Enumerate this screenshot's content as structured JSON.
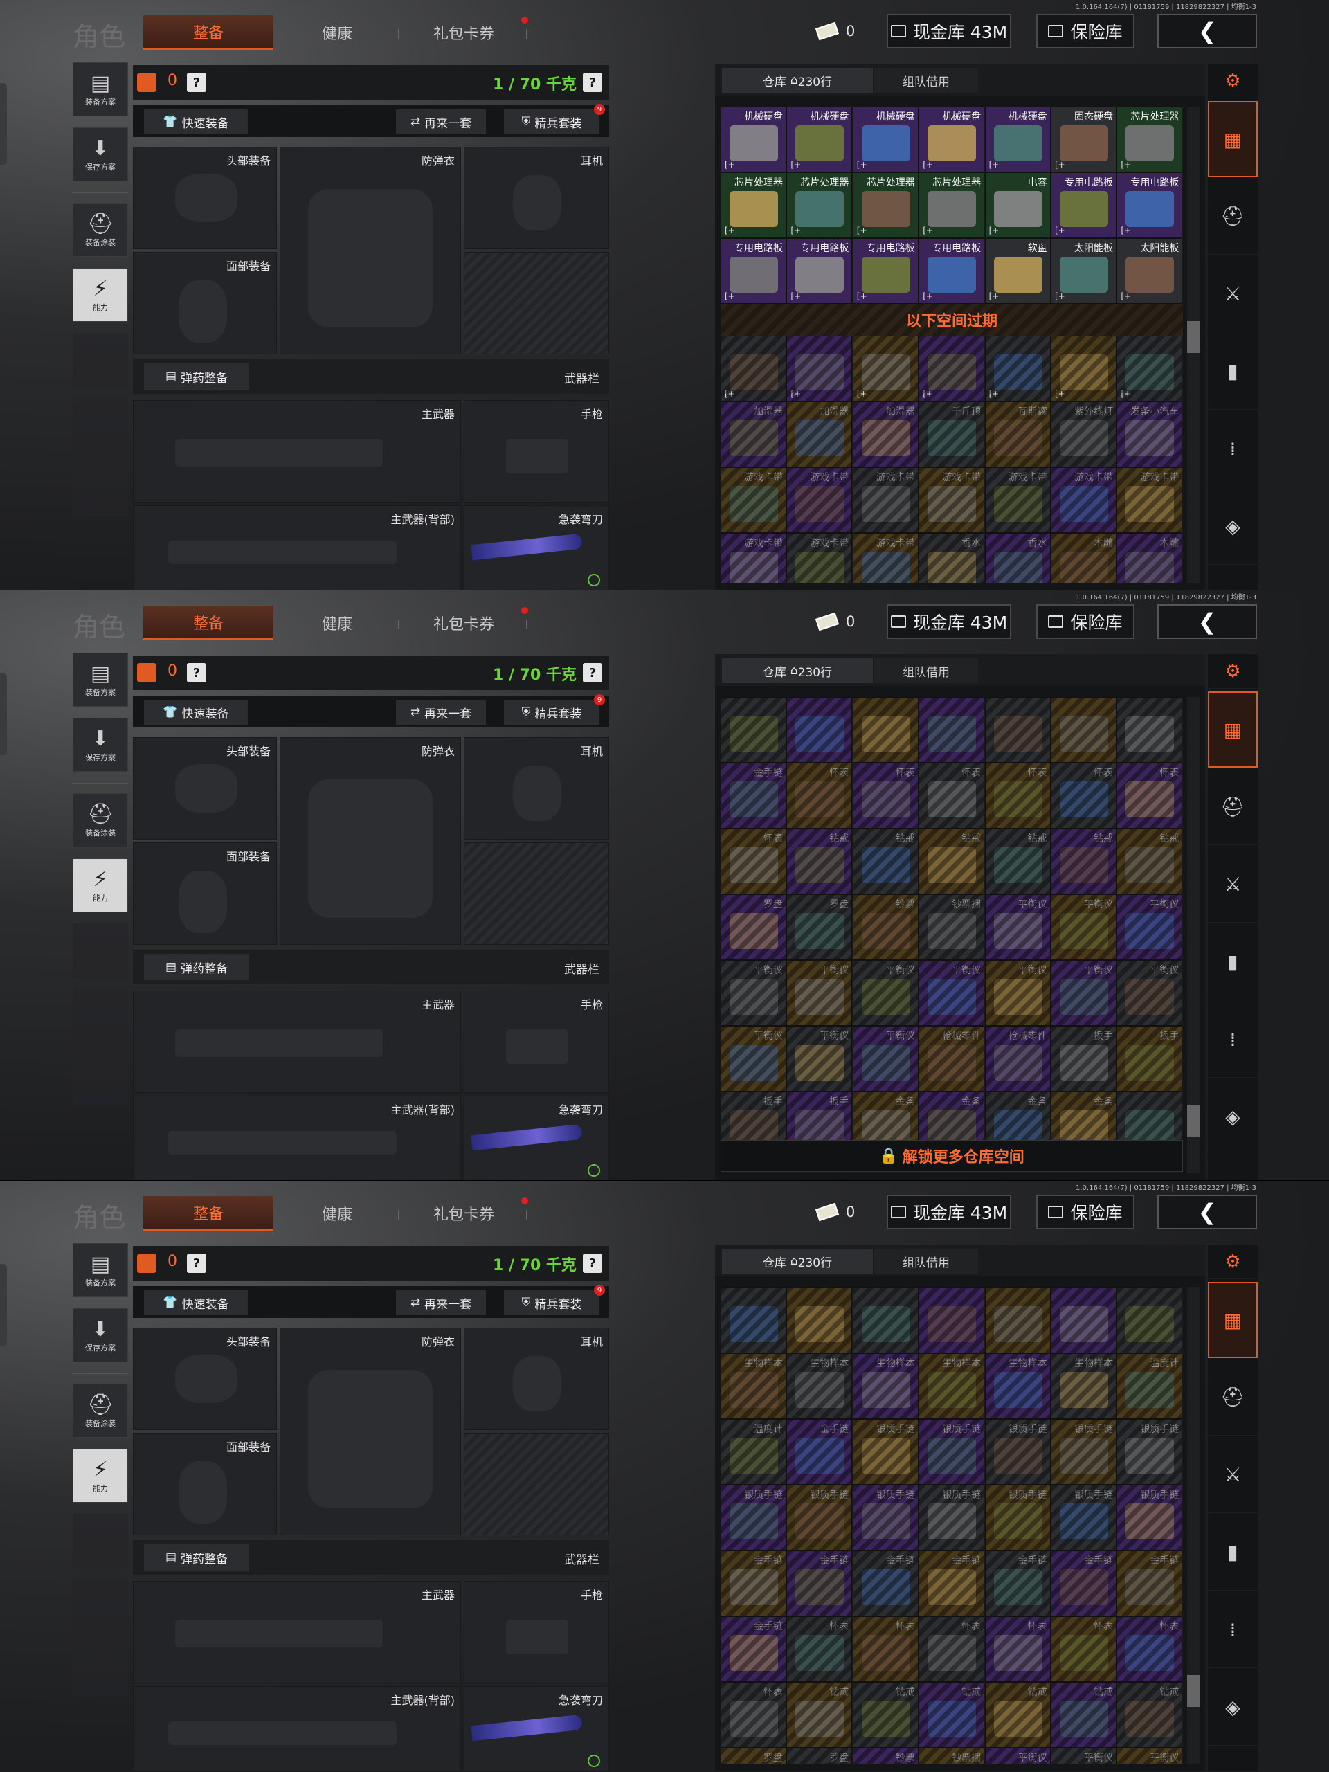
{
  "build": "1.0.164.164(7) | 01181759 | 11829822327 | 均衡1-3",
  "header": {
    "title": "角色",
    "tabs": [
      "整备",
      "健康",
      "礼包卡券"
    ],
    "cash_value": "0",
    "btn_cash": "现金库 43M",
    "btn_safe": "保险库"
  },
  "left_nav": [
    "装备方案",
    "保存方案",
    "装备涂装",
    "能力"
  ],
  "equipment": {
    "count": "0",
    "help": "?",
    "weight": "1 / 70 千克",
    "quick": "快速装备",
    "again": "再来一套",
    "elite": "精兵套装",
    "elite_badge": "9",
    "slots": {
      "head": "头部装备",
      "armor": "防弹衣",
      "ear": "耳机",
      "face": "面部装备",
      "ammo": "弹药整备",
      "weapons": "武器栏",
      "primary": "主武器",
      "pistol": "手枪",
      "back": "主武器(背部)",
      "knife": "急袭弯刀"
    }
  },
  "stash": {
    "tab_main": "仓库",
    "rows": "230行",
    "tab_team": "组队借用",
    "banner_expired": "以下空间过期",
    "banner_unlock": "解锁更多仓库空间",
    "plus": "[+",
    "views": [
      {
        "rows": [
          [
            [
              "机械硬盘",
              "#ffffff"
            ],
            [
              "机械硬盘",
              "#ffffff"
            ],
            [
              "机械硬盘",
              "#ffffff"
            ],
            [
              "机械硬盘",
              "#ffffff"
            ],
            [
              "机械硬盘",
              "#ffffff"
            ],
            [
              "固态硬盘",
              "#ffffff"
            ],
            [
              "芯片处理器",
              "#ffffff"
            ]
          ],
          [
            [
              "芯片处理器",
              "#ffffff"
            ],
            [
              "芯片处理器",
              "#ffffff"
            ],
            [
              "芯片处理器",
              "#ffffff"
            ],
            [
              "芯片处理器",
              "#ffffff"
            ],
            [
              "电容",
              "#ffffff"
            ],
            [
              "专用电路板",
              "#ffffff"
            ],
            [
              "专用电路板",
              "#ffffff"
            ]
          ],
          [
            [
              "专用电路板",
              "#ffffff"
            ],
            [
              "专用电路板",
              "#ffffff"
            ],
            [
              "专用电路板",
              "#ffffff"
            ],
            [
              "专用电路板",
              "#ffffff"
            ],
            [
              "软盘",
              "#ffffff"
            ],
            [
              "太阳能板",
              "#ffffff"
            ],
            [
              "太阳能板",
              "#ffffff"
            ]
          ],
          "expired",
          [
            [
              "",
              "#a0a0a0"
            ],
            [
              "",
              "#a0a0a0"
            ],
            [
              "",
              "#a0a0a0"
            ],
            [
              "",
              "#a0a0a0"
            ],
            [
              "",
              "#a0a0a0"
            ],
            [
              "",
              "#a0a0a0"
            ],
            [
              "",
              "#a0a0a0"
            ]
          ],
          [
            [
              "加湿器",
              "#a0a0a0"
            ],
            [
              "加湿器",
              "#a0a0a0"
            ],
            [
              "加湿器",
              "#a0a0a0"
            ],
            [
              "千斤顶",
              "#a0a0a0"
            ],
            [
              "瓦斯罐",
              "#a0a0a0"
            ],
            [
              "紫外线灯",
              "#a0a0a0"
            ],
            [
              "发条小汽车",
              "#a0a0a0"
            ]
          ],
          [
            [
              "游戏卡带",
              "#a0a0a0"
            ],
            [
              "游戏卡带",
              "#a0a0a0"
            ],
            [
              "游戏卡带",
              "#a0a0a0"
            ],
            [
              "游戏卡带",
              "#a0a0a0"
            ],
            [
              "游戏卡带",
              "#a0a0a0"
            ],
            [
              "游戏卡带",
              "#a0a0a0"
            ],
            [
              "游戏卡带",
              "#a0a0a0"
            ]
          ],
          [
            [
              "游戏卡带",
              "#a0a0a0"
            ],
            [
              "游戏卡带",
              "#a0a0a0"
            ],
            [
              "游戏卡带",
              "#a0a0a0"
            ],
            [
              "香水",
              "#a0a0a0"
            ],
            [
              "香水",
              "#a0a0a0"
            ],
            [
              "木雕",
              "#a0a0a0"
            ],
            [
              "木雕",
              "#a0a0a0"
            ]
          ]
        ]
      },
      {
        "rows": [
          [
            [
              "",
              "#a0a0a0"
            ],
            [
              "",
              "#a0a0a0"
            ],
            [
              "",
              "#a0a0a0"
            ],
            [
              "",
              "#a0a0a0"
            ],
            [
              "",
              "#a0a0a0"
            ],
            [
              "",
              "#a0a0a0"
            ],
            [
              "",
              "#a0a0a0"
            ]
          ],
          [
            [
              "金手链",
              "#a0a0a0"
            ],
            [
              "怀表",
              "#a0a0a0"
            ],
            [
              "怀表",
              "#a0a0a0"
            ],
            [
              "怀表",
              "#a0a0a0"
            ],
            [
              "怀表",
              "#a0a0a0"
            ],
            [
              "怀表",
              "#a0a0a0"
            ],
            [
              "怀表",
              "#a0a0a0"
            ]
          ],
          [
            [
              "怀表",
              "#a0a0a0"
            ],
            [
              "钻戒",
              "#a0a0a0"
            ],
            [
              "钻戒",
              "#a0a0a0"
            ],
            [
              "钻戒",
              "#a0a0a0"
            ],
            [
              "钻戒",
              "#a0a0a0"
            ],
            [
              "钻戒",
              "#a0a0a0"
            ],
            [
              "钻戒",
              "#a0a0a0"
            ]
          ],
          [
            [
              "罗盘",
              "#a0a0a0"
            ],
            [
              "罗盘",
              "#a0a0a0"
            ],
            [
              "钞票",
              "#a0a0a0"
            ],
            [
              "钞票捆",
              "#a0a0a0"
            ],
            [
              "平衡仪",
              "#a0a0a0"
            ],
            [
              "平衡仪",
              "#a0a0a0"
            ],
            [
              "平衡仪",
              "#a0a0a0"
            ]
          ],
          [
            [
              "平衡仪",
              "#a0a0a0"
            ],
            [
              "平衡仪",
              "#a0a0a0"
            ],
            [
              "平衡仪",
              "#a0a0a0"
            ],
            [
              "平衡仪",
              "#a0a0a0"
            ],
            [
              "平衡仪",
              "#a0a0a0"
            ],
            [
              "平衡仪",
              "#a0a0a0"
            ],
            [
              "平衡仪",
              "#a0a0a0"
            ]
          ],
          [
            [
              "平衡仪",
              "#a0a0a0"
            ],
            [
              "平衡仪",
              "#a0a0a0"
            ],
            [
              "平衡仪",
              "#a0a0a0"
            ],
            [
              "枪械零件",
              "#a0a0a0"
            ],
            [
              "枪械零件",
              "#a0a0a0"
            ],
            [
              "扳手",
              "#a0a0a0"
            ],
            [
              "扳手",
              "#a0a0a0"
            ]
          ],
          [
            [
              "扳手",
              "#a0a0a0"
            ],
            [
              "扳手",
              "#a0a0a0"
            ],
            [
              "金条",
              "#a0a0a0"
            ],
            [
              "金条",
              "#a0a0a0"
            ],
            [
              "金条",
              "#a0a0a0"
            ],
            [
              "金条",
              "#a0a0a0"
            ],
            [
              "",
              "#a0a0a0"
            ]
          ],
          "unlock"
        ]
      },
      {
        "rows": [
          [
            [
              "",
              "#a0a0a0"
            ],
            [
              "",
              "#a0a0a0"
            ],
            [
              "",
              "#a0a0a0"
            ],
            [
              "",
              "#a0a0a0"
            ],
            [
              "",
              "#a0a0a0"
            ],
            [
              "",
              "#a0a0a0"
            ],
            [
              "",
              "#a0a0a0"
            ]
          ],
          [
            [
              "生物样本",
              "#a0a0a0"
            ],
            [
              "生物样本",
              "#a0a0a0"
            ],
            [
              "生物样本",
              "#a0a0a0"
            ],
            [
              "生物样本",
              "#a0a0a0"
            ],
            [
              "生物样本",
              "#a0a0a0"
            ],
            [
              "生物样本",
              "#a0a0a0"
            ],
            [
              "温度计",
              "#a0a0a0"
            ]
          ],
          [
            [
              "温度计",
              "#a0a0a0"
            ],
            [
              "金手链",
              "#a0a0a0"
            ],
            [
              "银质手链",
              "#a0a0a0"
            ],
            [
              "银质手链",
              "#a0a0a0"
            ],
            [
              "银质手链",
              "#a0a0a0"
            ],
            [
              "银质手链",
              "#a0a0a0"
            ],
            [
              "银质手链",
              "#a0a0a0"
            ]
          ],
          [
            [
              "银质手链",
              "#a0a0a0"
            ],
            [
              "银质手链",
              "#a0a0a0"
            ],
            [
              "银质手链",
              "#a0a0a0"
            ],
            [
              "银质手链",
              "#a0a0a0"
            ],
            [
              "银质手链",
              "#a0a0a0"
            ],
            [
              "银质手链",
              "#a0a0a0"
            ],
            [
              "银质手链",
              "#a0a0a0"
            ]
          ],
          [
            [
              "金手链",
              "#a0a0a0"
            ],
            [
              "金手链",
              "#a0a0a0"
            ],
            [
              "金手链",
              "#a0a0a0"
            ],
            [
              "金手链",
              "#a0a0a0"
            ],
            [
              "金手链",
              "#a0a0a0"
            ],
            [
              "金手链",
              "#a0a0a0"
            ],
            [
              "金手链",
              "#a0a0a0"
            ]
          ],
          [
            [
              "金手链",
              "#a0a0a0"
            ],
            [
              "怀表",
              "#a0a0a0"
            ],
            [
              "怀表",
              "#a0a0a0"
            ],
            [
              "怀表",
              "#a0a0a0"
            ],
            [
              "怀表",
              "#a0a0a0"
            ],
            [
              "怀表",
              "#a0a0a0"
            ],
            [
              "怀表",
              "#a0a0a0"
            ]
          ],
          [
            [
              "怀表",
              "#a0a0a0"
            ],
            [
              "钻戒",
              "#a0a0a0"
            ],
            [
              "钻戒",
              "#a0a0a0"
            ],
            [
              "钻戒",
              "#a0a0a0"
            ],
            [
              "钻戒",
              "#a0a0a0"
            ],
            [
              "钻戒",
              "#a0a0a0"
            ],
            [
              "钻戒",
              "#a0a0a0"
            ]
          ],
          [
            [
              "罗盘",
              "#a0a0a0"
            ],
            [
              "罗盘",
              "#a0a0a0"
            ],
            [
              "钞票",
              "#a0a0a0"
            ],
            [
              "钞票捆",
              "#a0a0a0"
            ],
            [
              "平衡仪",
              "#a0a0a0"
            ],
            [
              "平衡仪",
              "#a0a0a0"
            ],
            [
              "平衡仪",
              "#a0a0a0"
            ]
          ]
        ]
      }
    ]
  },
  "colors": {
    "accent": "#ff6b32",
    "weight_green": "#6ad438",
    "cell_purple": "#3a2459",
    "cell_green": "#1d3a22",
    "cell_gold": "#4a3a1c",
    "cell_gray": "#2d2e31"
  },
  "category_icons": [
    "stash-settings-icon",
    "stash-all-icon",
    "armor-icon",
    "rifle-icon",
    "magazine-icon",
    "ammo-icon",
    "attachment-icon"
  ]
}
